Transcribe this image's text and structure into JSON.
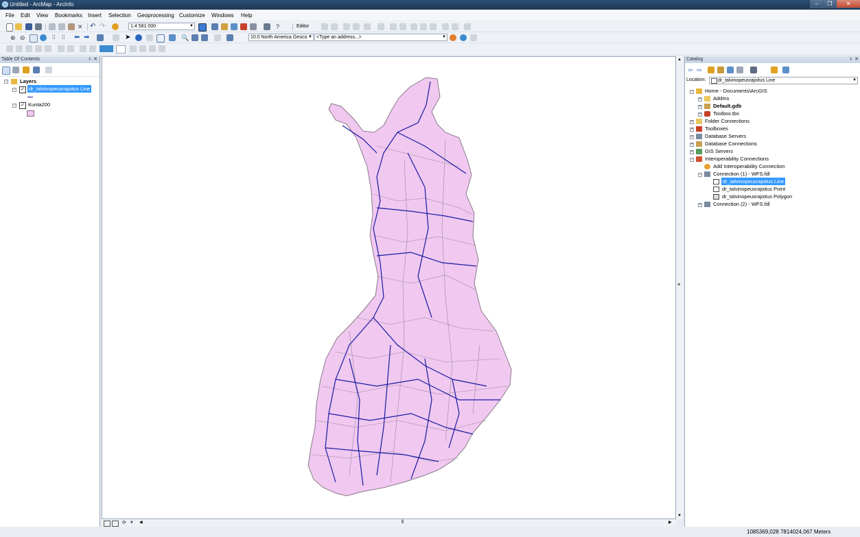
{
  "window": {
    "title": "Untitled - ArcMap - ArcInfo"
  },
  "menu": [
    "File",
    "Edit",
    "View",
    "Bookmarks",
    "Insert",
    "Selection",
    "Geoprocessing",
    "Customize",
    "Windows",
    "Help"
  ],
  "toolbar": {
    "scale": "1:4 581 000",
    "editor_label": "Editor",
    "geocoder": "10.0 North America Geoco",
    "address_placeholder": "<Type an address...>"
  },
  "toc": {
    "title": "Table Of Contents",
    "root": "Layers",
    "layers": [
      {
        "name": "dr_talvinopeusrajoitus Line",
        "checked": true,
        "selected": true
      },
      {
        "name": "Kunta200",
        "checked": true,
        "selected": false
      }
    ]
  },
  "catalog": {
    "title": "Catalog",
    "location_label": "Location:",
    "location_value": "dr_talvinopeusrajoitus Line",
    "tree": [
      "Home - Documents\\ArcGIS",
      "AddIns",
      "Default.gdb",
      "Toolbox.tbx",
      "Folder Connections",
      "Toolboxes",
      "Database Servers",
      "Database Connections",
      "GIS Servers",
      "Interoperability Connections",
      "Add Interoperability Connection",
      "Connection (1) -  WFS.fdl",
      "dr_talvinopeusrajoitus Line",
      "dr_talvinopeusrajoitus Point",
      "dr_talvinopeusrajoitus Polygon",
      "Connection (2) -  WFS.fdl"
    ]
  },
  "status": {
    "coordinates": "1085369,028  7814024,067 Meters"
  },
  "colors": {
    "selection": "#3399ff",
    "map_fill": "#f0c8f0",
    "road_lines": "#1a1aa0",
    "titlebar": "#1c3856"
  }
}
